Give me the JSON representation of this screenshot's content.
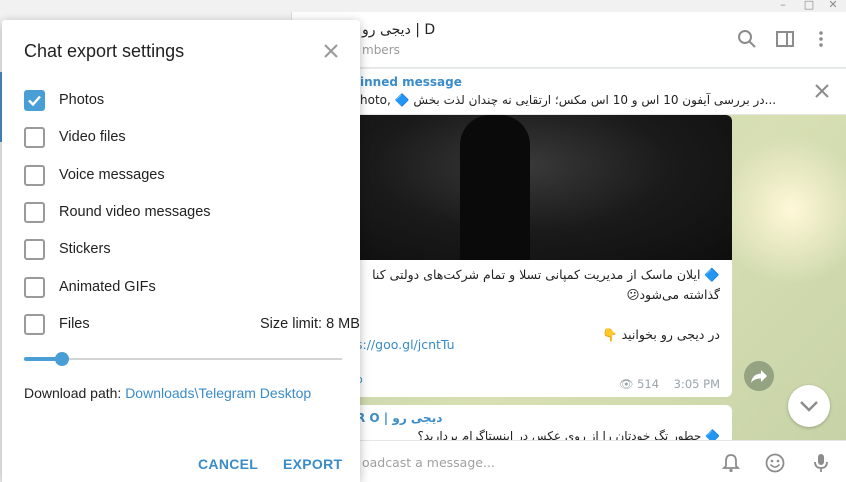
{
  "window": {
    "minimize_glyph": "–",
    "maximize_glyph": "□",
    "close_glyph": "✕"
  },
  "chat": {
    "title": "دیجی رو | D",
    "subtitle": "mbers",
    "pinned_title": "inned message",
    "pinned_text": "hoto, 🔷 در  بررسی آیفون 10 اس و 10 اس مکس؛ ارتقایی نه چندان لذت بخش...",
    "message_lines": [
      "🔷 ایلان ماسک از مدیریت کمپانی تسلا و تمام شرکت‌های دولتی کنا",
      "گذاشته می‌شود😕",
      "",
      "در دیجی رو بخوانید 👇"
    ],
    "message_link": "s://goo.gl/jcntTu",
    "message_views": "👁 514",
    "message_time": "3:05 PM",
    "message_dot": "o",
    "second_sender": "R O | دیجی رو",
    "second_text": "🔷 چطور تگ خودتان را از روی عکس در اینستاگرام بردارید؟",
    "input_placeholder": "oadcast a message..."
  },
  "dialog": {
    "title": "Chat export settings",
    "options": [
      {
        "label": "Photos",
        "checked": true
      },
      {
        "label": "Video files",
        "checked": false
      },
      {
        "label": "Voice messages",
        "checked": false
      },
      {
        "label": "Round video messages",
        "checked": false
      },
      {
        "label": "Stickers",
        "checked": false
      },
      {
        "label": "Animated GIFs",
        "checked": false
      },
      {
        "label": "Files",
        "checked": false
      }
    ],
    "size_limit": "Size limit: 8 MB",
    "slider_fraction": 0.12,
    "download_label": "Download path:",
    "download_path": "Downloads\\Telegram Desktop",
    "cancel_label": "CANCEL",
    "export_label": "EXPORT"
  },
  "colors": {
    "accent": "#4a9ed6",
    "link": "#3a8cc8"
  },
  "icons": [
    "search-icon",
    "sidebar-toggle-icon",
    "more-vert-icon",
    "close-icon",
    "share-icon",
    "scroll-down-icon",
    "bell-icon",
    "emoji-icon",
    "microphone-icon",
    "check-icon"
  ]
}
